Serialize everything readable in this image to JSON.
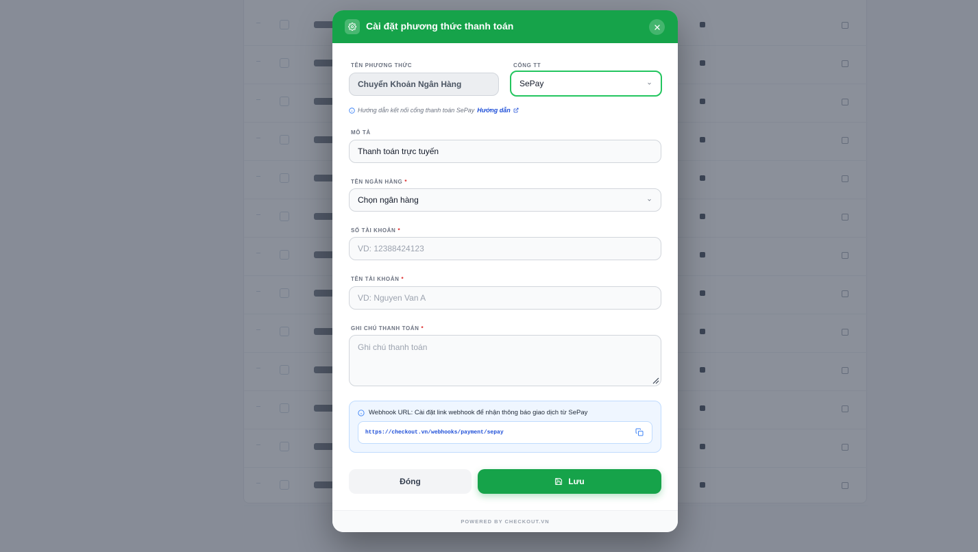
{
  "modal": {
    "title": "Cài đặt phương thức thanh toán",
    "method_name": {
      "label": "TÊN PHƯƠNG THỨC",
      "value": "Chuyển Khoản Ngân Hàng"
    },
    "gateway": {
      "label": "CỔNG TT",
      "value": "SePay"
    },
    "hint": {
      "text": "Hướng dẫn kết nối cổng thanh toán SePay",
      "link": "Hướng dẫn"
    },
    "description": {
      "label": "MÔ TẢ",
      "value": "Thanh toán trực tuyến"
    },
    "bank_name": {
      "label": "TÊN NGÂN HÀNG",
      "value": "Chọn ngân hàng",
      "required": "*"
    },
    "account_number": {
      "label": "SỐ TÀI KHOẢN",
      "placeholder": "VD: 12388424123",
      "required": "*"
    },
    "account_name": {
      "label": "TÊN TÀI KHOẢN",
      "placeholder": "VD: Nguyen Van A",
      "required": "*"
    },
    "payment_note": {
      "label": "GHI CHÚ THANH TOÁN",
      "placeholder": "Ghi chú thanh toán",
      "required": "*"
    },
    "webhook": {
      "title": "Webhook URL: Cài đặt link webhook để nhận thông báo giao dịch từ SePay",
      "url": "https://checkout.vn/webhooks/payment/sepay"
    },
    "buttons": {
      "close": "Đóng",
      "save": "Lưu"
    },
    "footer": "POWERED BY CHECKOUT.VN"
  },
  "colors": {
    "primary": "#16a34a",
    "accent_border": "#22c55e",
    "link": "#1d4ed8",
    "required": "#dc2626"
  }
}
